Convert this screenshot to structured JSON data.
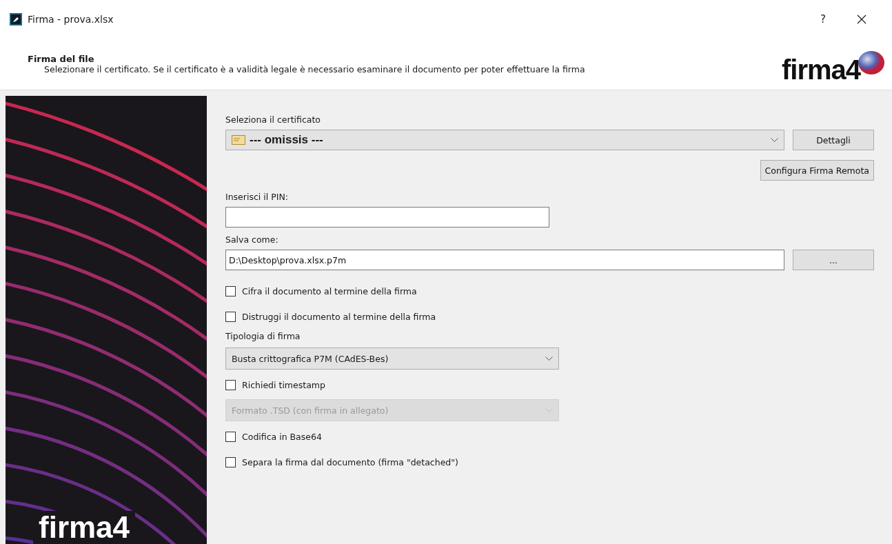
{
  "window": {
    "title": "Firma - prova.xlsx",
    "help_button": "?"
  },
  "header": {
    "title": "Firma del file",
    "description": "Selezionare il certificato. Se il certificato è a validità legale è necessario esaminare il documento per poter effettuare la firma",
    "logo": "firma4"
  },
  "banner": {
    "logo": "firma4"
  },
  "certificate": {
    "label": "Seleziona il certificato",
    "value": "--- omissis ---",
    "details_button": "Dettagli"
  },
  "remote_button": "Configura Firma Remota",
  "pin": {
    "label": "Inserisci il PIN:"
  },
  "save_as": {
    "label": "Salva come:",
    "value": "D:\\Desktop\\prova.xlsx.p7m",
    "browse_button": "..."
  },
  "options": [
    {
      "kind": "checkbox",
      "label": "Cifra il documento al termine della firma",
      "checked": false
    },
    {
      "kind": "checkbox",
      "label": "Distruggi il documento al termine della firma",
      "checked": false
    },
    {
      "kind": "label",
      "text": "Tipologia di firma"
    },
    {
      "kind": "combo",
      "value": "Busta crittografica P7M (CAdES-Bes)",
      "disabled": false
    },
    {
      "kind": "checkbox",
      "label": "Richiedi timestamp",
      "checked": false
    },
    {
      "kind": "combo",
      "value": "Formato .TSD (con firma in allegato)",
      "disabled": true
    },
    {
      "kind": "checkbox",
      "label": "Codifica in Base64",
      "checked": false
    },
    {
      "kind": "checkbox",
      "label": "Separa la firma dal documento (firma \"detached\")",
      "checked": false
    }
  ]
}
